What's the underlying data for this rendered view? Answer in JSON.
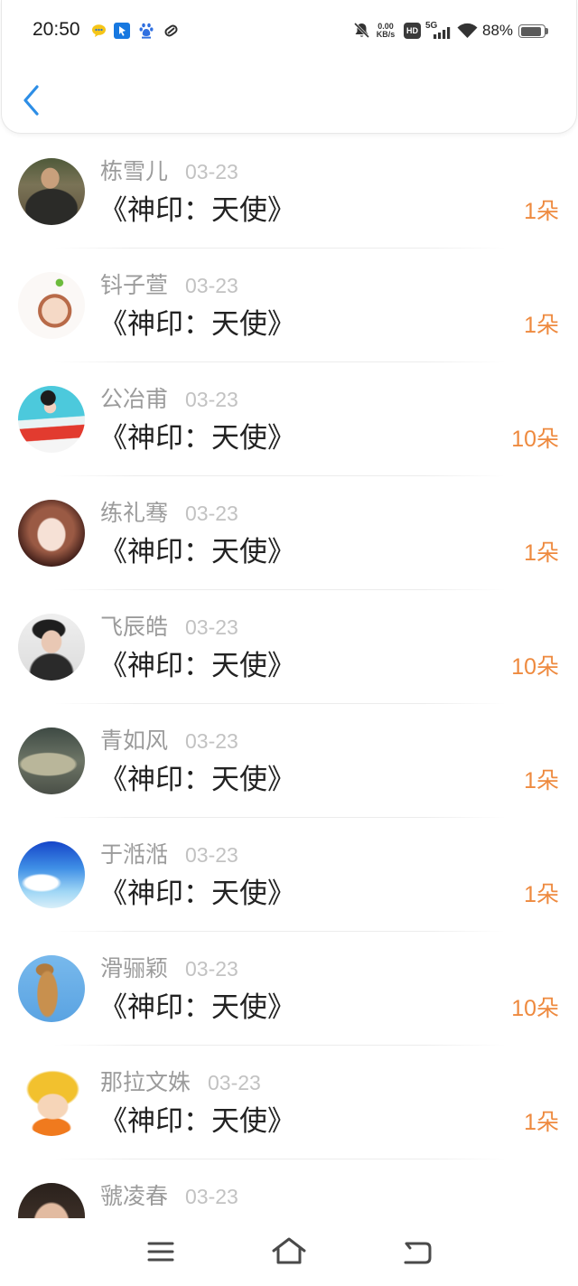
{
  "status_bar": {
    "time": "20:50",
    "notification_icons": [
      "chat-bubble-icon",
      "cursor-app-icon",
      "paw-icon",
      "loop-icon"
    ],
    "system_icons": [
      "bell-muted-icon",
      "signal-bars-icon",
      "wifi-icon",
      "battery-icon"
    ],
    "net_speed_value": "0.00",
    "net_speed_unit": "KB/s",
    "hd_label": "HD",
    "network_type": "5G",
    "battery_percent": "88%",
    "battery_level": 0.88
  },
  "header": {
    "back_icon": "chevron-left-icon",
    "accent_color": "#2d8ee6"
  },
  "list": {
    "flower_color": "#ee8a3f",
    "items": [
      {
        "name": "栋雪儿",
        "date": "03-23",
        "title": "《神印：天使》",
        "flowers": "1朵"
      },
      {
        "name": "钭子萱",
        "date": "03-23",
        "title": "《神印：天使》",
        "flowers": "1朵"
      },
      {
        "name": "公冶甫",
        "date": "03-23",
        "title": "《神印：天使》",
        "flowers": "10朵"
      },
      {
        "name": "练礼骞",
        "date": "03-23",
        "title": "《神印：天使》",
        "flowers": "1朵"
      },
      {
        "name": "飞辰皓",
        "date": "03-23",
        "title": "《神印：天使》",
        "flowers": "10朵"
      },
      {
        "name": "青如风",
        "date": "03-23",
        "title": "《神印：天使》",
        "flowers": "1朵"
      },
      {
        "name": "于湉湉",
        "date": "03-23",
        "title": "《神印：天使》",
        "flowers": "1朵"
      },
      {
        "name": "滑骊颖",
        "date": "03-23",
        "title": "《神印：天使》",
        "flowers": "10朵"
      },
      {
        "name": "那拉文姝",
        "date": "03-23",
        "title": "《神印：天使》",
        "flowers": "1朵"
      },
      {
        "name": "虢凌春",
        "date": "03-23"
      }
    ]
  },
  "nav_bar": {
    "icons": [
      "menu-icon",
      "home-icon",
      "back-icon"
    ]
  }
}
